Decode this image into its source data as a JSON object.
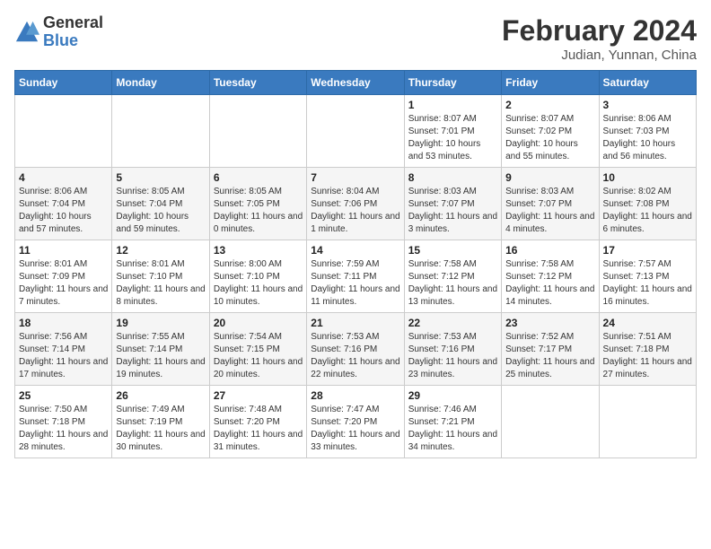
{
  "header": {
    "logo_general": "General",
    "logo_blue": "Blue",
    "month_year": "February 2024",
    "location": "Judian, Yunnan, China"
  },
  "weekdays": [
    "Sunday",
    "Monday",
    "Tuesday",
    "Wednesday",
    "Thursday",
    "Friday",
    "Saturday"
  ],
  "weeks": [
    [
      {
        "day": "",
        "info": ""
      },
      {
        "day": "",
        "info": ""
      },
      {
        "day": "",
        "info": ""
      },
      {
        "day": "",
        "info": ""
      },
      {
        "day": "1",
        "info": "Sunrise: 8:07 AM\nSunset: 7:01 PM\nDaylight: 10 hours and 53 minutes."
      },
      {
        "day": "2",
        "info": "Sunrise: 8:07 AM\nSunset: 7:02 PM\nDaylight: 10 hours and 55 minutes."
      },
      {
        "day": "3",
        "info": "Sunrise: 8:06 AM\nSunset: 7:03 PM\nDaylight: 10 hours and 56 minutes."
      }
    ],
    [
      {
        "day": "4",
        "info": "Sunrise: 8:06 AM\nSunset: 7:04 PM\nDaylight: 10 hours and 57 minutes."
      },
      {
        "day": "5",
        "info": "Sunrise: 8:05 AM\nSunset: 7:04 PM\nDaylight: 10 hours and 59 minutes."
      },
      {
        "day": "6",
        "info": "Sunrise: 8:05 AM\nSunset: 7:05 PM\nDaylight: 11 hours and 0 minutes."
      },
      {
        "day": "7",
        "info": "Sunrise: 8:04 AM\nSunset: 7:06 PM\nDaylight: 11 hours and 1 minute."
      },
      {
        "day": "8",
        "info": "Sunrise: 8:03 AM\nSunset: 7:07 PM\nDaylight: 11 hours and 3 minutes."
      },
      {
        "day": "9",
        "info": "Sunrise: 8:03 AM\nSunset: 7:07 PM\nDaylight: 11 hours and 4 minutes."
      },
      {
        "day": "10",
        "info": "Sunrise: 8:02 AM\nSunset: 7:08 PM\nDaylight: 11 hours and 6 minutes."
      }
    ],
    [
      {
        "day": "11",
        "info": "Sunrise: 8:01 AM\nSunset: 7:09 PM\nDaylight: 11 hours and 7 minutes."
      },
      {
        "day": "12",
        "info": "Sunrise: 8:01 AM\nSunset: 7:10 PM\nDaylight: 11 hours and 8 minutes."
      },
      {
        "day": "13",
        "info": "Sunrise: 8:00 AM\nSunset: 7:10 PM\nDaylight: 11 hours and 10 minutes."
      },
      {
        "day": "14",
        "info": "Sunrise: 7:59 AM\nSunset: 7:11 PM\nDaylight: 11 hours and 11 minutes."
      },
      {
        "day": "15",
        "info": "Sunrise: 7:58 AM\nSunset: 7:12 PM\nDaylight: 11 hours and 13 minutes."
      },
      {
        "day": "16",
        "info": "Sunrise: 7:58 AM\nSunset: 7:12 PM\nDaylight: 11 hours and 14 minutes."
      },
      {
        "day": "17",
        "info": "Sunrise: 7:57 AM\nSunset: 7:13 PM\nDaylight: 11 hours and 16 minutes."
      }
    ],
    [
      {
        "day": "18",
        "info": "Sunrise: 7:56 AM\nSunset: 7:14 PM\nDaylight: 11 hours and 17 minutes."
      },
      {
        "day": "19",
        "info": "Sunrise: 7:55 AM\nSunset: 7:14 PM\nDaylight: 11 hours and 19 minutes."
      },
      {
        "day": "20",
        "info": "Sunrise: 7:54 AM\nSunset: 7:15 PM\nDaylight: 11 hours and 20 minutes."
      },
      {
        "day": "21",
        "info": "Sunrise: 7:53 AM\nSunset: 7:16 PM\nDaylight: 11 hours and 22 minutes."
      },
      {
        "day": "22",
        "info": "Sunrise: 7:53 AM\nSunset: 7:16 PM\nDaylight: 11 hours and 23 minutes."
      },
      {
        "day": "23",
        "info": "Sunrise: 7:52 AM\nSunset: 7:17 PM\nDaylight: 11 hours and 25 minutes."
      },
      {
        "day": "24",
        "info": "Sunrise: 7:51 AM\nSunset: 7:18 PM\nDaylight: 11 hours and 27 minutes."
      }
    ],
    [
      {
        "day": "25",
        "info": "Sunrise: 7:50 AM\nSunset: 7:18 PM\nDaylight: 11 hours and 28 minutes."
      },
      {
        "day": "26",
        "info": "Sunrise: 7:49 AM\nSunset: 7:19 PM\nDaylight: 11 hours and 30 minutes."
      },
      {
        "day": "27",
        "info": "Sunrise: 7:48 AM\nSunset: 7:20 PM\nDaylight: 11 hours and 31 minutes."
      },
      {
        "day": "28",
        "info": "Sunrise: 7:47 AM\nSunset: 7:20 PM\nDaylight: 11 hours and 33 minutes."
      },
      {
        "day": "29",
        "info": "Sunrise: 7:46 AM\nSunset: 7:21 PM\nDaylight: 11 hours and 34 minutes."
      },
      {
        "day": "",
        "info": ""
      },
      {
        "day": "",
        "info": ""
      }
    ]
  ]
}
